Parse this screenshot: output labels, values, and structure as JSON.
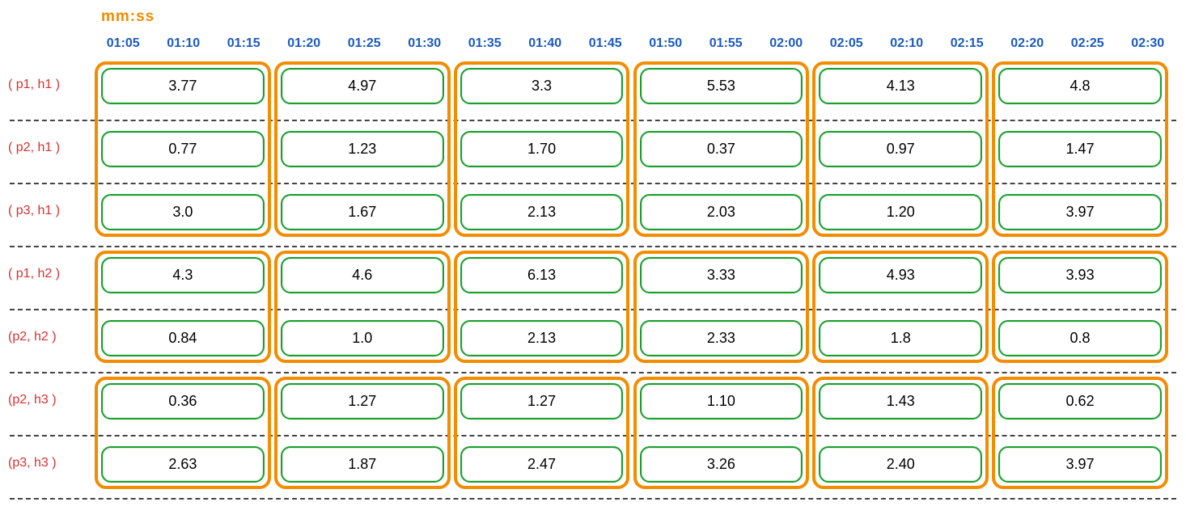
{
  "header_label": "mm:ss",
  "time_groups": [
    [
      "01:05",
      "01:10",
      "01:15"
    ],
    [
      "01:20",
      "01:25",
      "01:30"
    ],
    [
      "01:35",
      "01:40",
      "01:45"
    ],
    [
      "01:50",
      "01:55",
      "02:00"
    ],
    [
      "02:05",
      "02:10",
      "02:15"
    ],
    [
      "02:20",
      "02:25",
      "02:30"
    ]
  ],
  "rows": [
    {
      "label": "( p1, h1 )",
      "group": 0
    },
    {
      "label": "( p2, h1 )",
      "group": 0
    },
    {
      "label": "( p3, h1 )",
      "group": 0
    },
    {
      "label": "( p1, h2 )",
      "group": 1
    },
    {
      "label": "(p2, h2 )",
      "group": 1
    },
    {
      "label": "(p2, h3 )",
      "group": 2
    },
    {
      "label": "(p3, h3 )",
      "group": 2
    }
  ],
  "cells": [
    [
      "3.77",
      "4.97",
      "3.3",
      "5.53",
      "4.13",
      "4.8"
    ],
    [
      "0.77",
      "1.23",
      "1.70",
      "0.37",
      "0.97",
      "1.47"
    ],
    [
      "3.0",
      "1.67",
      "2.13",
      "2.03",
      "1.20",
      "3.97"
    ],
    [
      "4.3",
      "4.6",
      "6.13",
      "3.33",
      "4.93",
      "3.93"
    ],
    [
      "0.84",
      "1.0",
      "2.13",
      "2.33",
      "1.8",
      "0.8"
    ],
    [
      "0.36",
      "1.27",
      "1.27",
      "1.10",
      "1.43",
      "0.62"
    ],
    [
      "2.63",
      "1.87",
      "2.47",
      "3.26",
      "2.40",
      "3.97"
    ]
  ],
  "chart_data": {
    "type": "table",
    "title": "mm:ss",
    "x_categories_major": [
      "01:05–01:15",
      "01:20–01:30",
      "01:35–01:45",
      "01:50–02:00",
      "02:05–02:15",
      "02:20–02:30"
    ],
    "x_categories_minor": [
      "01:05",
      "01:10",
      "01:15",
      "01:20",
      "01:25",
      "01:30",
      "01:35",
      "01:40",
      "01:45",
      "01:50",
      "01:55",
      "02:00",
      "02:05",
      "02:10",
      "02:15",
      "02:20",
      "02:25",
      "02:30"
    ],
    "series": [
      {
        "name": "(p1, h1)",
        "values": [
          3.77,
          4.97,
          3.3,
          5.53,
          4.13,
          4.8
        ]
      },
      {
        "name": "(p2, h1)",
        "values": [
          0.77,
          1.23,
          1.7,
          0.37,
          0.97,
          1.47
        ]
      },
      {
        "name": "(p3, h1)",
        "values": [
          3.0,
          1.67,
          2.13,
          2.03,
          1.2,
          3.97
        ]
      },
      {
        "name": "(p1, h2)",
        "values": [
          4.3,
          4.6,
          6.13,
          3.33,
          4.93,
          3.93
        ]
      },
      {
        "name": "(p2, h2)",
        "values": [
          0.84,
          1.0,
          2.13,
          2.33,
          1.8,
          0.8
        ]
      },
      {
        "name": "(p2, h3)",
        "values": [
          0.36,
          1.27,
          1.27,
          1.1,
          1.43,
          0.62
        ]
      },
      {
        "name": "(p3, h3)",
        "values": [
          2.63,
          1.87,
          2.47,
          3.26,
          2.4,
          3.97
        ]
      }
    ],
    "row_groups": {
      "h1": [
        "(p1, h1)",
        "(p2, h1)",
        "(p3, h1)"
      ],
      "h2": [
        "(p1, h2)",
        "(p2, h2)"
      ],
      "h3": [
        "(p2, h3)",
        "(p3, h3)"
      ]
    }
  }
}
